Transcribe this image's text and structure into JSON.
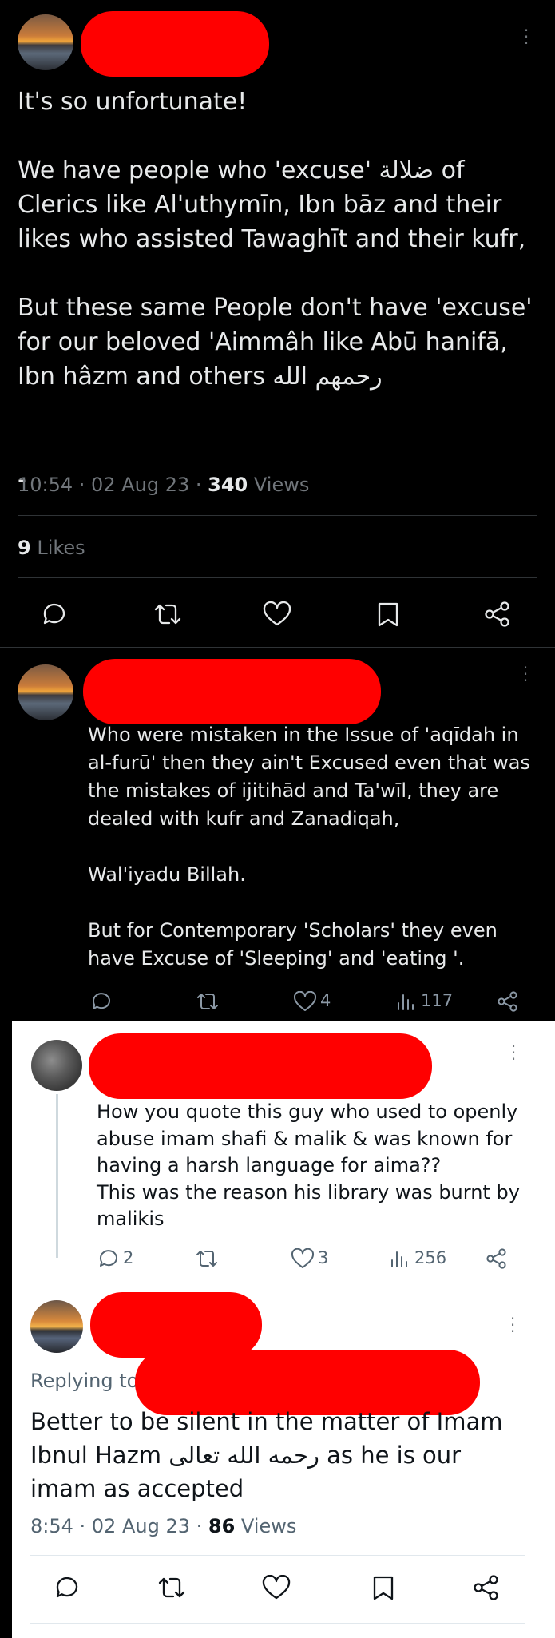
{
  "post1": {
    "text": "It's so unfortunate!\n\nWe have people who 'excuse' ضلالة  of Clerics like Al'uthymīn, Ibn bāz and their likes who assisted Tawaghīt and their kufr,\n\nBut these same People don't have 'excuse' for our beloved 'Aimmâh like Abū hanifā, Ibn hâzm and others رحمهم الله\n\n\n-",
    "time": "10:54 · 02 Aug 23 · ",
    "views_count": "340",
    "views_label": " Views",
    "likes_count": "9",
    "likes_label": " Likes"
  },
  "reply1": {
    "text": "Who were mistaken in the Issue of 'aqīdah in al-furū' then they ain't Excused even that was the mistakes of ijitihād and Ta'wīl, they are dealed with kufr and Zanadiqah,\n\nWal'iyadu Billah.\n\nBut for Contemporary 'Scholars' they even have Excuse of 'Sleeping' and 'eating '.",
    "likes": "4",
    "views": "117"
  },
  "reply2": {
    "text": "How you quote this guy who used to openly abuse imam shafi & malik & was known for having a harsh language for aima??\nThis was the reason his library was burnt by malikis",
    "replies": "2",
    "likes": "3",
    "views": "256"
  },
  "reply3": {
    "replying_label": "Replying to",
    "text": "Better to be silent in the matter of Imam Ibnul Hazm رحمه الله تعالى as he is our imam as accepted",
    "time": "8:54 · 02 Aug 23 · ",
    "views_count": "86",
    "views_label": " Views"
  },
  "icons": [
    "reply-icon",
    "retweet-icon",
    "like-icon",
    "bookmark-icon",
    "share-icon",
    "views-icon",
    "more-icon"
  ]
}
